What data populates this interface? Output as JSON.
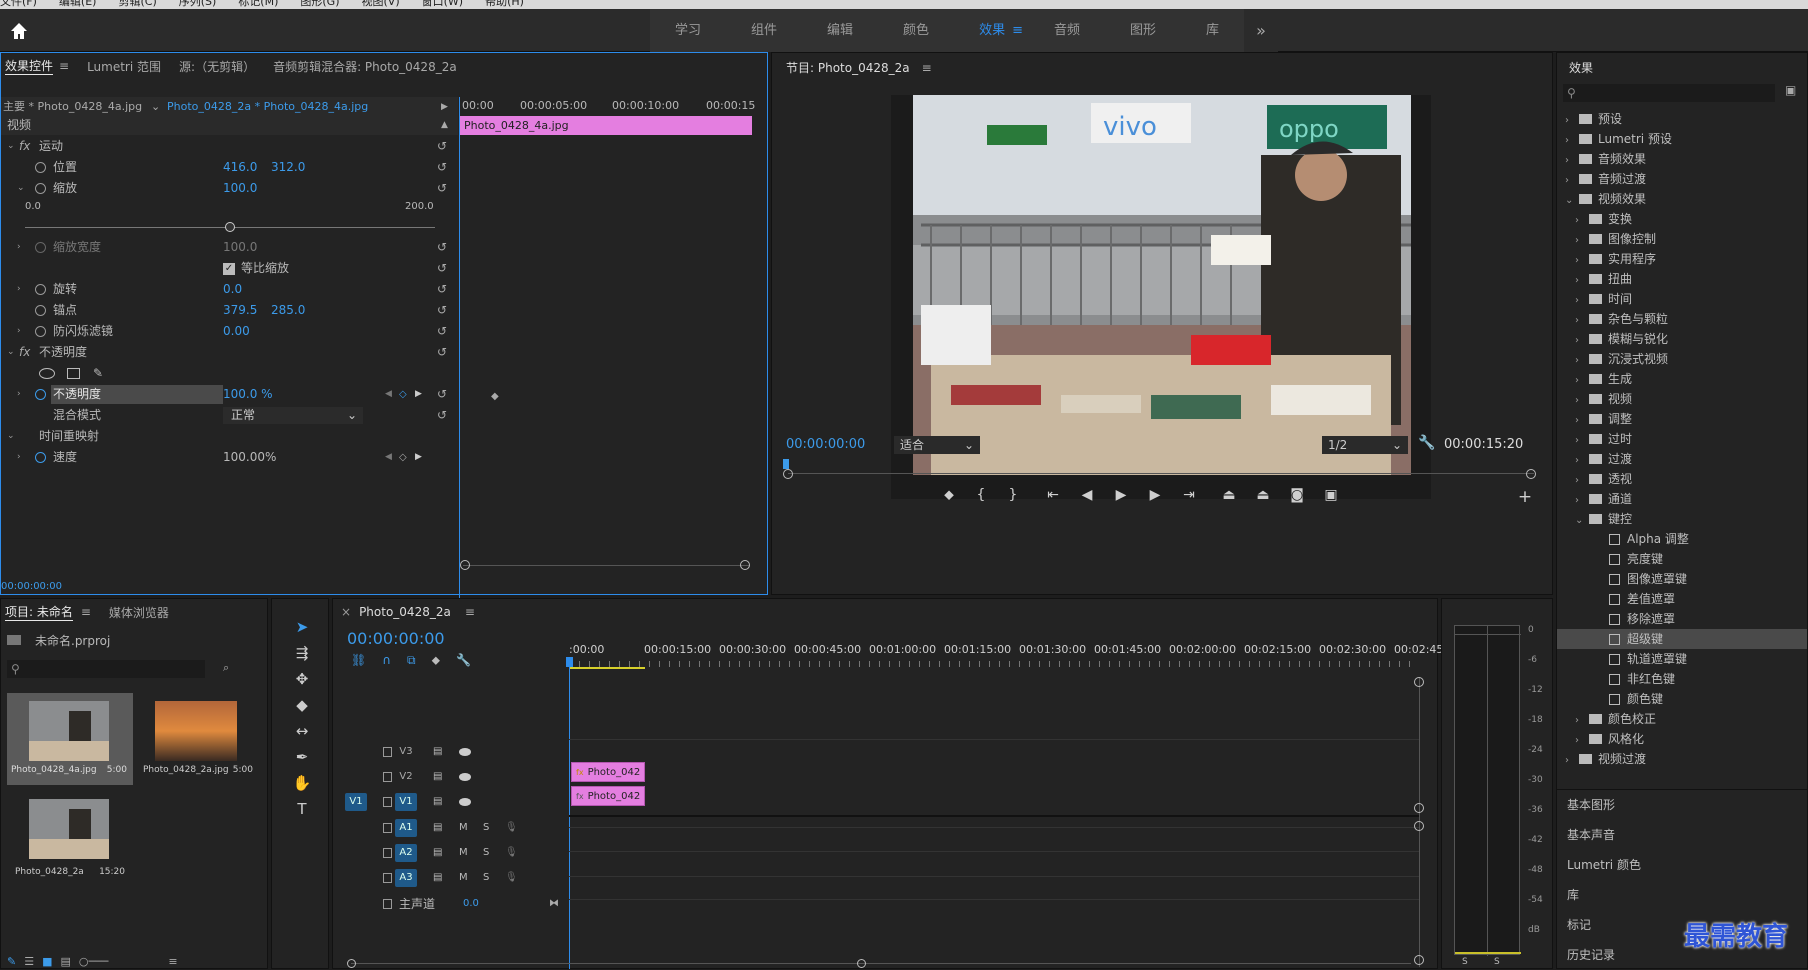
{
  "menubar": [
    "文件(F)",
    "编辑(E)",
    "剪辑(C)",
    "序列(S)",
    "标记(M)",
    "图形(G)",
    "视图(V)",
    "窗口(W)",
    "帮助(H)"
  ],
  "workspace_tabs": [
    {
      "label": "学习"
    },
    {
      "label": "组件"
    },
    {
      "label": "编辑"
    },
    {
      "label": "颜色"
    },
    {
      "label": "效果",
      "active": true
    },
    {
      "label": "音频"
    },
    {
      "label": "图形"
    },
    {
      "label": "库"
    }
  ],
  "overflow_label": "»",
  "effect_controls": {
    "tabs": [
      "效果控件",
      "Lumetri 范围",
      "源:（无剪辑）",
      "音频剪辑混合器: Photo_0428_2a"
    ],
    "main_clip": "主要 * Photo_0428_4a.jpg",
    "seq_clip": "Photo_0428_2a * Photo_0428_4a.jpg",
    "timecodes": [
      "00:00",
      "00:00:05:00",
      "00:00:10:00",
      "00:00:15"
    ],
    "clip_bar": "Photo_0428_4a.jpg",
    "section_video": "视频",
    "motion": "运动",
    "position": {
      "label": "位置",
      "x": "416.0",
      "y": "312.0"
    },
    "scale": {
      "label": "缩放",
      "value": "100.0",
      "min": "0.0",
      "max": "200.0"
    },
    "scale_width": {
      "label": "缩放宽度",
      "value": "100.0"
    },
    "uniform_scale": "等比缩放",
    "rotation": {
      "label": "旋转",
      "value": "0.0"
    },
    "anchor": {
      "label": "锚点",
      "x": "379.5",
      "y": "285.0"
    },
    "antiflicker": {
      "label": "防闪烁滤镜",
      "value": "0.00"
    },
    "opacity_section": "不透明度",
    "opacity": {
      "label": "不透明度",
      "value": "100.0 %"
    },
    "blend_mode": {
      "label": "混合模式",
      "value": "正常"
    },
    "time_remap": "时间重映射",
    "speed": {
      "label": "速度",
      "value": "100.00%"
    },
    "bottom_time": "00:00:00:00"
  },
  "program": {
    "title": "节目: Photo_0428_2a",
    "current_time": "00:00:00:00",
    "fit": "适合",
    "resolution": "1/2",
    "duration": "00:00:15:20"
  },
  "effects_panel": {
    "title": "效果",
    "items": [
      {
        "label": "预设",
        "level": 0,
        "type": "folder",
        "open": false
      },
      {
        "label": "Lumetri 预设",
        "level": 0,
        "type": "folder",
        "open": false
      },
      {
        "label": "音频效果",
        "level": 0,
        "type": "folder",
        "open": false
      },
      {
        "label": "音频过渡",
        "level": 0,
        "type": "folder",
        "open": false
      },
      {
        "label": "视频效果",
        "level": 0,
        "type": "folder",
        "open": true
      },
      {
        "label": "变换",
        "level": 1,
        "type": "folder",
        "open": false
      },
      {
        "label": "图像控制",
        "level": 1,
        "type": "folder",
        "open": false
      },
      {
        "label": "实用程序",
        "level": 1,
        "type": "folder",
        "open": false
      },
      {
        "label": "扭曲",
        "level": 1,
        "type": "folder",
        "open": false
      },
      {
        "label": "时间",
        "level": 1,
        "type": "folder",
        "open": false
      },
      {
        "label": "杂色与颗粒",
        "level": 1,
        "type": "folder",
        "open": false
      },
      {
        "label": "模糊与锐化",
        "level": 1,
        "type": "folder",
        "open": false
      },
      {
        "label": "沉浸式视频",
        "level": 1,
        "type": "folder",
        "open": false
      },
      {
        "label": "生成",
        "level": 1,
        "type": "folder",
        "open": false
      },
      {
        "label": "视频",
        "level": 1,
        "type": "folder",
        "open": false
      },
      {
        "label": "调整",
        "level": 1,
        "type": "folder",
        "open": false
      },
      {
        "label": "过时",
        "level": 1,
        "type": "folder",
        "open": false
      },
      {
        "label": "过渡",
        "level": 1,
        "type": "folder",
        "open": false
      },
      {
        "label": "透视",
        "level": 1,
        "type": "folder",
        "open": false
      },
      {
        "label": "通道",
        "level": 1,
        "type": "folder",
        "open": false
      },
      {
        "label": "键控",
        "level": 1,
        "type": "folder",
        "open": true
      },
      {
        "label": "Alpha 调整",
        "level": 2,
        "type": "fx"
      },
      {
        "label": "亮度键",
        "level": 2,
        "type": "fx"
      },
      {
        "label": "图像遮罩键",
        "level": 2,
        "type": "fx"
      },
      {
        "label": "差值遮罩",
        "level": 2,
        "type": "fx"
      },
      {
        "label": "移除遮罩",
        "level": 2,
        "type": "fx"
      },
      {
        "label": "超级键",
        "level": 2,
        "type": "fx",
        "selected": true
      },
      {
        "label": "轨道遮罩键",
        "level": 2,
        "type": "fx"
      },
      {
        "label": "非红色键",
        "level": 2,
        "type": "fx"
      },
      {
        "label": "颜色键",
        "level": 2,
        "type": "fx"
      },
      {
        "label": "颜色校正",
        "level": 1,
        "type": "folder",
        "open": false
      },
      {
        "label": "风格化",
        "level": 1,
        "type": "folder",
        "open": false
      },
      {
        "label": "视频过渡",
        "level": 0,
        "type": "folder",
        "open": false
      }
    ],
    "links": [
      "基本图形",
      "基本声音",
      "Lumetri 颜色",
      "库",
      "标记",
      "历史记录"
    ]
  },
  "project": {
    "tabs": [
      "项目: 未命名",
      "媒体浏览器"
    ],
    "file": "未命名.prproj",
    "items": [
      {
        "name": "Photo_0428_4a.jpg",
        "duration": "5:00"
      },
      {
        "name": "Photo_0428_2a.jpg",
        "duration": "5:00"
      },
      {
        "name": "Photo_0428_2a",
        "duration": "15:20"
      }
    ]
  },
  "timeline": {
    "tab": "Photo_0428_2a",
    "timecode": "00:00:00:00",
    "ruler": [
      ":00:00",
      "00:00:15:00",
      "00:00:30:00",
      "00:00:45:00",
      "00:01:00:00",
      "00:01:15:00",
      "00:01:30:00",
      "00:01:45:00",
      "00:02:00:00",
      "00:02:15:00",
      "00:02:30:00",
      "00:02:45:"
    ],
    "tracks": [
      {
        "source": "",
        "name": "V3"
      },
      {
        "source": "",
        "name": "V2"
      },
      {
        "source": "V1",
        "name": "V1"
      },
      {
        "source": "",
        "name": "A1"
      },
      {
        "source": "",
        "name": "A2"
      },
      {
        "source": "",
        "name": "A3"
      }
    ],
    "master": {
      "label": "主声道",
      "value": "0.0"
    },
    "clips": [
      "Photo_042",
      "Photo_042"
    ],
    "mute": "M",
    "solo": "S"
  },
  "meter": {
    "labels": [
      "0",
      "-6",
      "-12",
      "-18",
      "-24",
      "-30",
      "-36",
      "-42",
      "-48",
      "-54",
      "dB"
    ],
    "s": "S"
  },
  "watermark": "最需教育"
}
